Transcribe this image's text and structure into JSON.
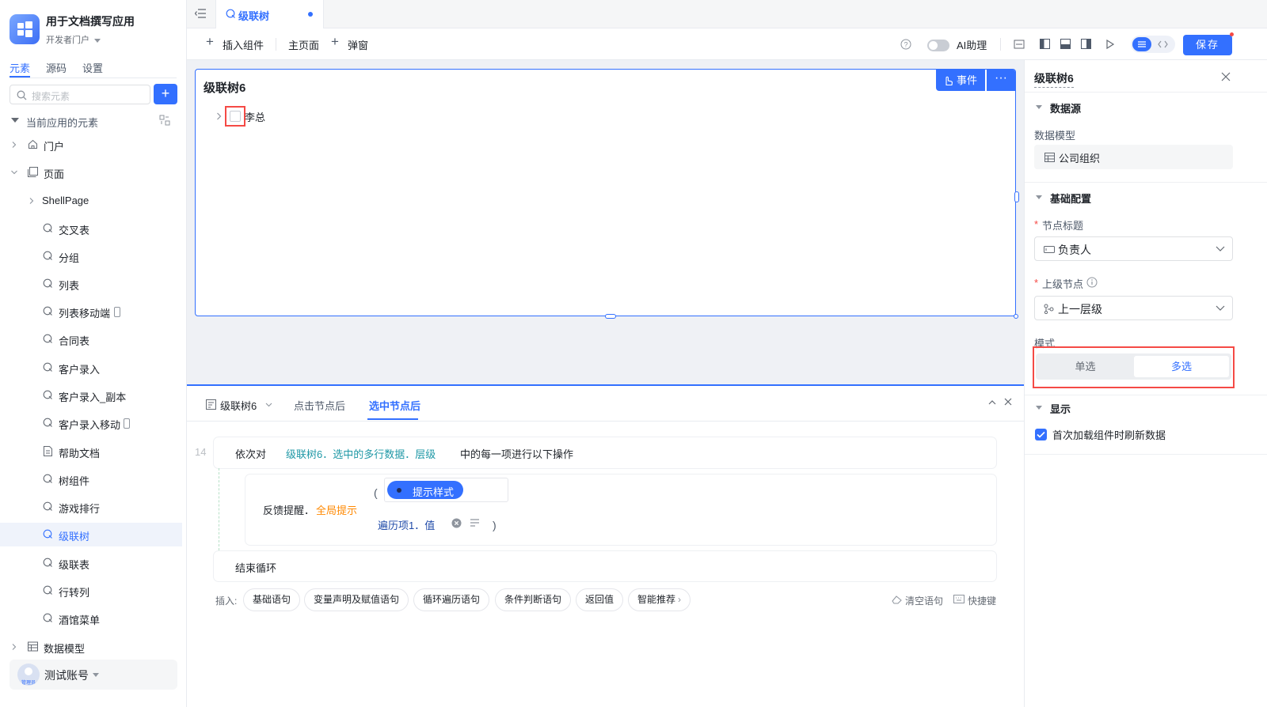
{
  "app": {
    "title": "用于文档撰写应用",
    "subtitle": "开发者门户"
  },
  "sidebar": {
    "tabs": [
      "元素",
      "源码",
      "设置"
    ],
    "search_placeholder": "搜索元素",
    "section_title": "当前应用的元素",
    "items": [
      {
        "label": "门户",
        "icon": "home-icon"
      },
      {
        "label": "页面",
        "icon": "pages-icon"
      },
      {
        "label": "ShellPage",
        "icon": ""
      },
      {
        "label": "交叉表",
        "icon": "page-icon"
      },
      {
        "label": "分组",
        "icon": "page-icon"
      },
      {
        "label": "列表",
        "icon": "page-icon"
      },
      {
        "label": "列表移动端",
        "icon": "page-icon"
      },
      {
        "label": "合同表",
        "icon": "page-icon"
      },
      {
        "label": "客户录入",
        "icon": "page-icon"
      },
      {
        "label": "客户录入_副本",
        "icon": "page-icon"
      },
      {
        "label": "客户录入移动",
        "icon": "page-icon"
      },
      {
        "label": "帮助文档",
        "icon": "doc-icon"
      },
      {
        "label": "树组件",
        "icon": "page-icon"
      },
      {
        "label": "游戏排行",
        "icon": "page-icon"
      },
      {
        "label": "级联树",
        "icon": "page-icon"
      },
      {
        "label": "级联表",
        "icon": "page-icon"
      },
      {
        "label": "行转列",
        "icon": "page-icon"
      },
      {
        "label": "酒馆菜单",
        "icon": "page-icon"
      },
      {
        "label": "数据模型",
        "icon": "table-icon"
      }
    ],
    "account": {
      "name": "测试账号",
      "role": "管理员"
    }
  },
  "tabbar": {
    "active_tab": "级联树"
  },
  "toolbar": {
    "insert": "插入组件",
    "home": "主页面",
    "popup": "弹窗",
    "ai": "AI助理",
    "save": "保存"
  },
  "canvas": {
    "component_title": "级联树6",
    "event_label": "事件",
    "tree_node": "李总"
  },
  "logic": {
    "tabs": [
      "级联树6",
      "点击节点后",
      "选中节点后"
    ],
    "line_no": "14",
    "loop_prefix": "依次对",
    "loop_target": "级联树6．选中的多行数据．层级",
    "loop_suffix": "中的每一项进行以下操作",
    "feedback_fn": "反馈提醒．",
    "feedback_kind": "全局提示",
    "paren_open": "(",
    "paren_close": ")",
    "style_pill": "提示样式",
    "iter_value": "遍历项1．值",
    "end_loop": "结束循环",
    "insert_label": "插入:",
    "chips": [
      "基础语句",
      "变量声明及赋值语句",
      "循环遍历语句",
      "条件判断语句",
      "返回值",
      "智能推荐"
    ],
    "clear": "清空语句",
    "shortcut": "快捷键"
  },
  "props": {
    "title": "级联树6",
    "datasource_section": "数据源",
    "model_label": "数据模型",
    "model_value": "公司组织",
    "basic_section": "基础配置",
    "node_title_label": "节点标题",
    "node_title_value": "负责人",
    "parent_label": "上级节点",
    "parent_value": "上一层级",
    "mode_label": "模式",
    "mode_single": "单选",
    "mode_multi": "多选",
    "display_section": "显示",
    "refresh_label": "首次加载组件时刷新数据",
    "refresh_checked": true
  },
  "colors": {
    "accent": "#3370ff",
    "highlight": "#f54a45",
    "orange": "#ff8800",
    "teal": "#1f98a6"
  }
}
